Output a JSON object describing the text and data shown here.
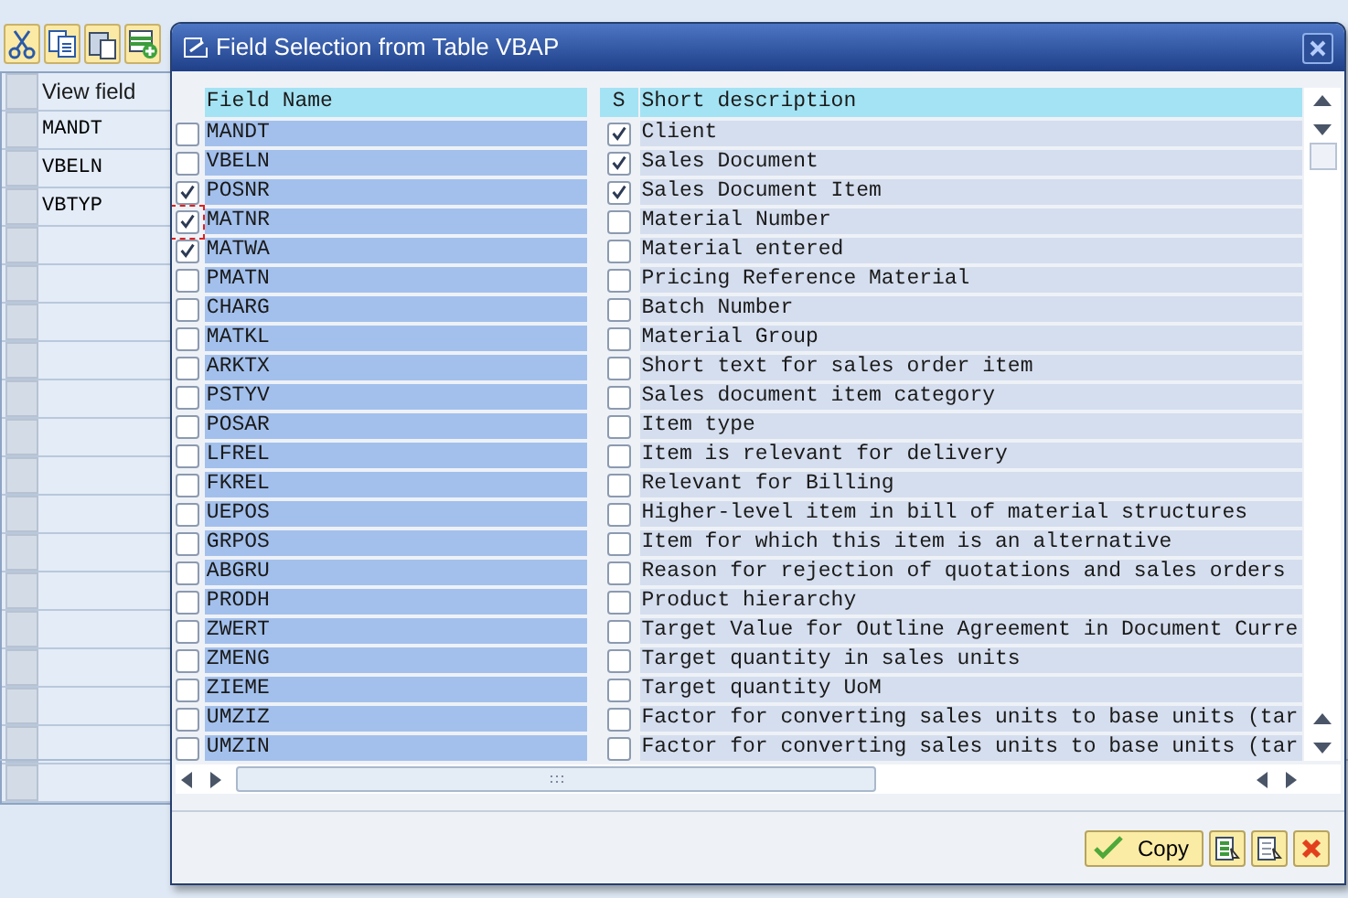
{
  "background": {
    "table": {
      "columns": [
        "View field"
      ],
      "rows": [
        "MANDT",
        "VBELN",
        "VBTYP"
      ]
    }
  },
  "dialog": {
    "title": "Field Selection from Table VBAP",
    "columns": [
      "Field Name",
      "S",
      "Short description"
    ],
    "rows": [
      {
        "name": "MANDT",
        "selected": false,
        "key": true,
        "description": "Client",
        "focused": false
      },
      {
        "name": "VBELN",
        "selected": false,
        "key": true,
        "description": "Sales Document",
        "focused": false
      },
      {
        "name": "POSNR",
        "selected": true,
        "key": true,
        "description": "Sales Document Item",
        "focused": false
      },
      {
        "name": "MATNR",
        "selected": true,
        "key": false,
        "description": "Material Number",
        "focused": true
      },
      {
        "name": "MATWA",
        "selected": true,
        "key": false,
        "description": "Material entered",
        "focused": false
      },
      {
        "name": "PMATN",
        "selected": false,
        "key": false,
        "description": "Pricing Reference Material",
        "focused": false
      },
      {
        "name": "CHARG",
        "selected": false,
        "key": false,
        "description": "Batch Number",
        "focused": false
      },
      {
        "name": "MATKL",
        "selected": false,
        "key": false,
        "description": "Material Group",
        "focused": false
      },
      {
        "name": "ARKTX",
        "selected": false,
        "key": false,
        "description": "Short text for sales order item",
        "focused": false
      },
      {
        "name": "PSTYV",
        "selected": false,
        "key": false,
        "description": "Sales document item category",
        "focused": false
      },
      {
        "name": "POSAR",
        "selected": false,
        "key": false,
        "description": "Item type",
        "focused": false
      },
      {
        "name": "LFREL",
        "selected": false,
        "key": false,
        "description": "Item is relevant for delivery",
        "focused": false
      },
      {
        "name": "FKREL",
        "selected": false,
        "key": false,
        "description": "Relevant for Billing",
        "focused": false
      },
      {
        "name": "UEPOS",
        "selected": false,
        "key": false,
        "description": "Higher-level item in bill of material structures",
        "focused": false
      },
      {
        "name": "GRPOS",
        "selected": false,
        "key": false,
        "description": "Item for which this item is an alternative",
        "focused": false
      },
      {
        "name": "ABGRU",
        "selected": false,
        "key": false,
        "description": "Reason for rejection of quotations and sales orders",
        "focused": false
      },
      {
        "name": "PRODH",
        "selected": false,
        "key": false,
        "description": "Product hierarchy",
        "focused": false
      },
      {
        "name": "ZWERT",
        "selected": false,
        "key": false,
        "description": "Target Value for Outline Agreement in Document Curre",
        "focused": false
      },
      {
        "name": "ZMENG",
        "selected": false,
        "key": false,
        "description": "Target quantity in sales units",
        "focused": false
      },
      {
        "name": "ZIEME",
        "selected": false,
        "key": false,
        "description": "Target quantity UoM",
        "focused": false
      },
      {
        "name": "UMZIZ",
        "selected": false,
        "key": false,
        "description": "Factor for converting sales units to base units (tar",
        "focused": false
      },
      {
        "name": "UMZIN",
        "selected": false,
        "key": false,
        "description": "Factor for converting sales units to base units (tar",
        "focused": false
      }
    ],
    "buttons": [
      "Copy"
    ]
  }
}
